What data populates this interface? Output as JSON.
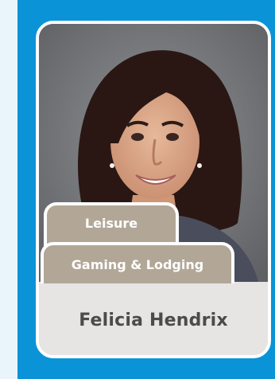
{
  "profile": {
    "name": "Felicia Hendrix",
    "photo_alt": "Portrait photo",
    "tags": [
      "Leisure",
      "Gaming & Lodging"
    ]
  },
  "colors": {
    "page_bg": "#e9f5fb",
    "panel": "#0b93d8",
    "card_border": "#ffffff",
    "tab_bg": "#b2a797",
    "name_bg": "#e6e5e3",
    "name_text": "#4b4b4b"
  }
}
